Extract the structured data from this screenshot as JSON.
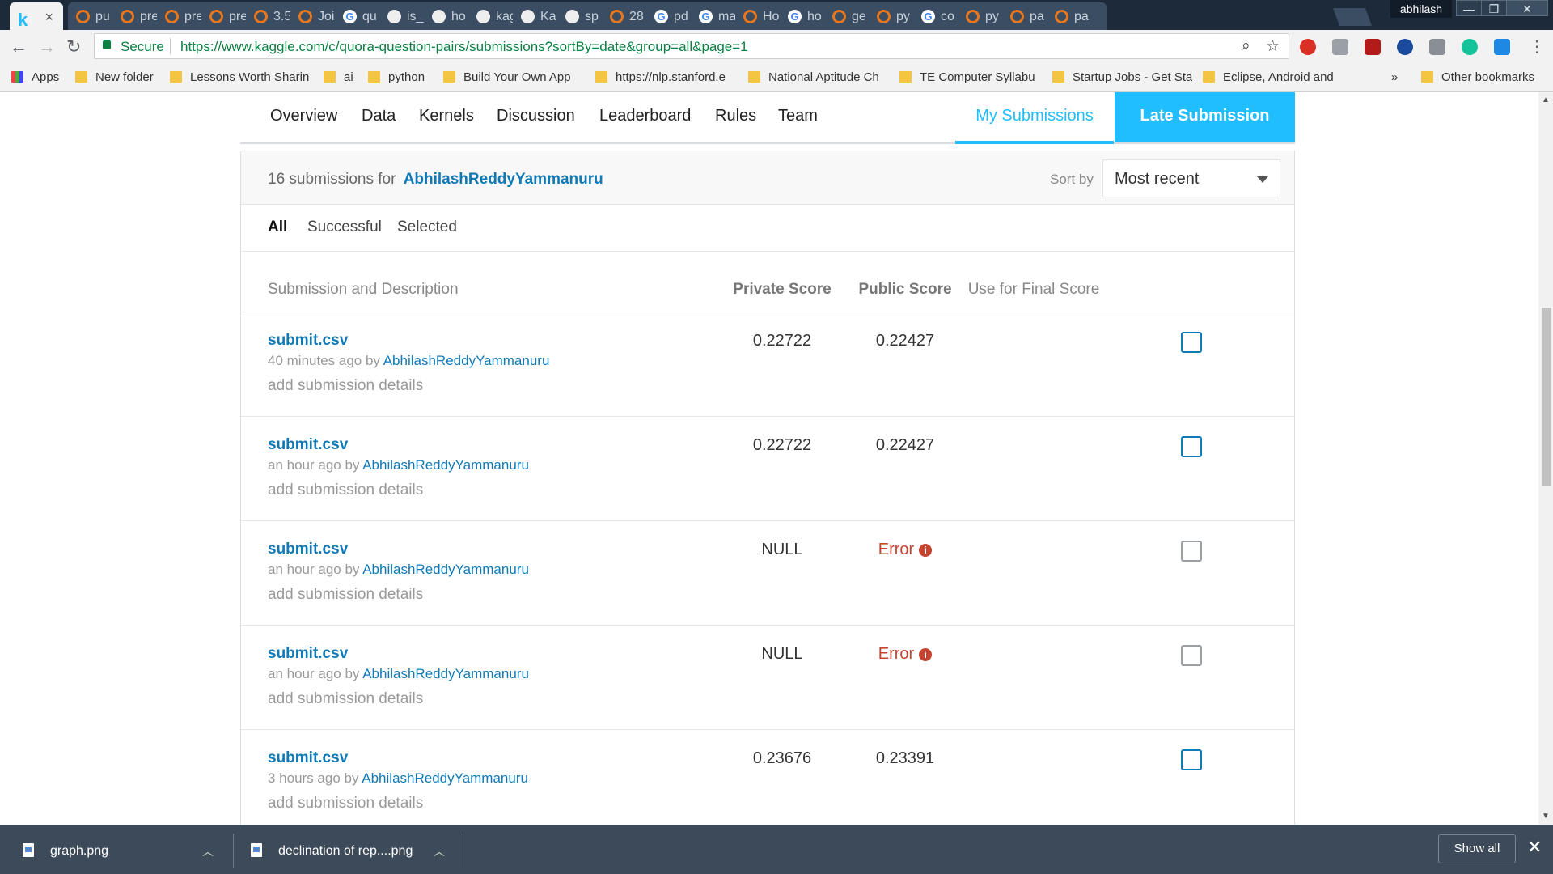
{
  "browser": {
    "active_tab": {
      "logo": "k",
      "close": "×"
    },
    "tabs": [
      {
        "label": "pu",
        "icon": "ring-icon"
      },
      {
        "label": "pre",
        "icon": "ring-icon"
      },
      {
        "label": "pre",
        "icon": "ring-icon"
      },
      {
        "label": "pre",
        "icon": "ring-icon"
      },
      {
        "label": "3.5",
        "icon": "tab-icon"
      },
      {
        "label": "Joi",
        "icon": "tab-icon"
      },
      {
        "label": "qu",
        "icon": "google-icon"
      },
      {
        "label": "is_",
        "icon": "github-icon"
      },
      {
        "label": "ho",
        "icon": "github-icon"
      },
      {
        "label": "kag",
        "icon": "github-icon"
      },
      {
        "label": "Ka",
        "icon": "github-icon"
      },
      {
        "label": "sp",
        "icon": "github-icon"
      },
      {
        "label": "28",
        "icon": "tab-icon"
      },
      {
        "label": "pd",
        "icon": "google-icon"
      },
      {
        "label": "ma",
        "icon": "google-icon"
      },
      {
        "label": "Ho",
        "icon": "tab-icon"
      },
      {
        "label": "ho",
        "icon": "google-icon"
      },
      {
        "label": "ge",
        "icon": "tab-icon"
      },
      {
        "label": "py",
        "icon": "tab-icon"
      },
      {
        "label": "co",
        "icon": "google-icon"
      },
      {
        "label": "py",
        "icon": "tab-icon"
      },
      {
        "label": "pa",
        "icon": "page-icon"
      },
      {
        "label": "pa",
        "icon": "page-icon"
      }
    ],
    "profile": "abhilash",
    "window_buttons": [
      "—",
      "❐",
      "✕"
    ],
    "secure_label": "Secure",
    "url": "https://www.kaggle.com/c/quora-question-pairs/submissions?sortBy=date&group=all&page=1",
    "bookmarks": [
      {
        "label": "Apps"
      },
      {
        "label": "New folder"
      },
      {
        "label": "Lessons Worth Sharin"
      },
      {
        "label": "ai"
      },
      {
        "label": "python"
      },
      {
        "label": "Build Your Own App"
      },
      {
        "label": "https://nlp.stanford.e"
      },
      {
        "label": "National Aptitude Ch"
      },
      {
        "label": "TE Computer Syllabu"
      },
      {
        "label": "Startup Jobs - Get Sta"
      },
      {
        "label": "Eclipse, Android and"
      }
    ],
    "bookmarks_more": "»",
    "other_bookmarks": "Other bookmarks"
  },
  "competition_nav": {
    "items": [
      "Overview",
      "Data",
      "Kernels",
      "Discussion",
      "Leaderboard",
      "Rules",
      "Team"
    ],
    "my_submissions": "My Submissions",
    "late_submission": "Late Submission"
  },
  "submissions": {
    "count_text": "16 submissions for",
    "owner": "AbhilashReddyYammanuru",
    "sort_label": "Sort by",
    "sort_value": "Most recent",
    "filters": [
      "All",
      "Successful",
      "Selected"
    ],
    "columns": {
      "description": "Submission and Description",
      "private": "Private Score",
      "public": "Public Score",
      "final": "Use for Final Score"
    },
    "rows": [
      {
        "file": "submit.csv",
        "time": "40 minutes ago by",
        "user": "AbhilashReddyYammanuru",
        "details": "add submission details",
        "private": "0.22722",
        "public": "0.22427",
        "error": false
      },
      {
        "file": "submit.csv",
        "time": "an hour ago by",
        "user": "AbhilashReddyYammanuru",
        "details": "add submission details",
        "private": "0.22722",
        "public": "0.22427",
        "error": false
      },
      {
        "file": "submit.csv",
        "time": "an hour ago by",
        "user": "AbhilashReddyYammanuru",
        "details": "add submission details",
        "private": "NULL",
        "public": "Error",
        "error": true
      },
      {
        "file": "submit.csv",
        "time": "an hour ago by",
        "user": "AbhilashReddyYammanuru",
        "details": "add submission details",
        "private": "NULL",
        "public": "Error",
        "error": true
      },
      {
        "file": "submit.csv",
        "time": "3 hours ago by",
        "user": "AbhilashReddyYammanuru",
        "details": "add submission details",
        "private": "0.23676",
        "public": "0.23391",
        "error": false
      }
    ]
  },
  "downloads": {
    "items": [
      {
        "name": "graph.png"
      },
      {
        "name": "declination of rep....png"
      }
    ],
    "show_all": "Show all",
    "close": "✕"
  },
  "colors": {
    "accent": "#20beff",
    "link": "#0f7ab6",
    "error": "#c6432f"
  }
}
